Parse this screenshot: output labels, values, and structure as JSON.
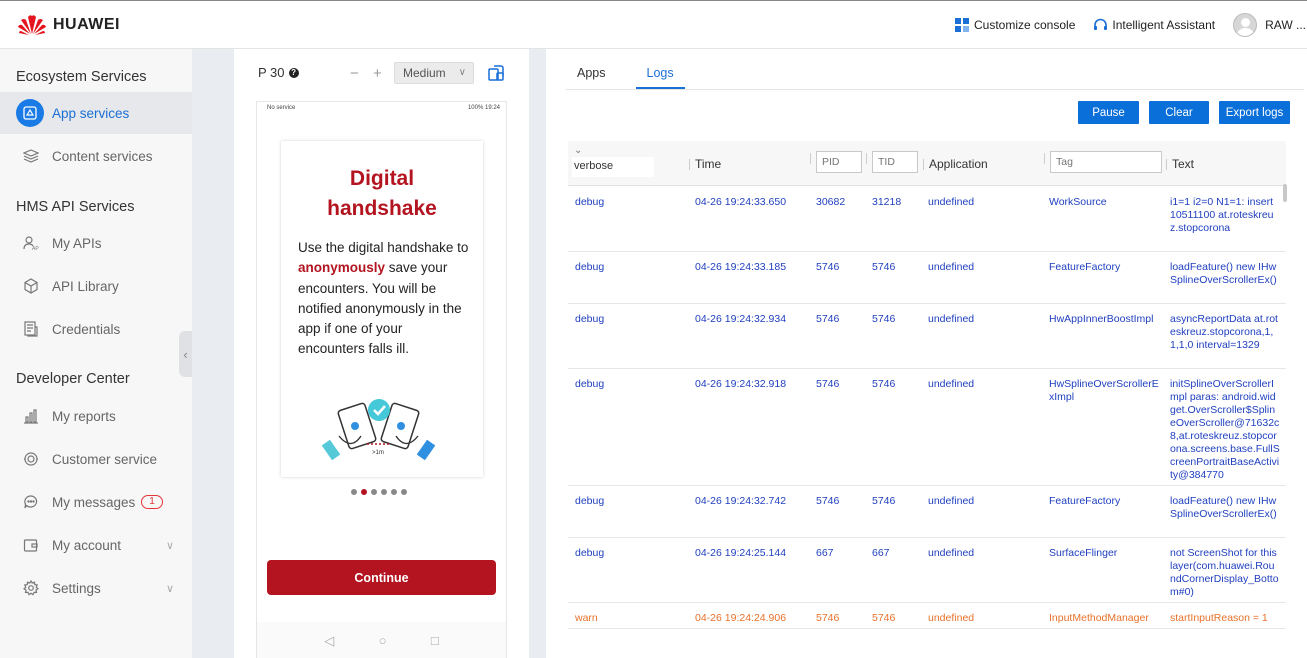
{
  "header": {
    "brand": "HUAWEI",
    "customize": "Customize console",
    "assistant": "Intelligent Assistant",
    "user": "RAW ..."
  },
  "sidebar": {
    "section1": "Ecosystem Services",
    "items1": [
      {
        "label": "App services",
        "icon": "app-services-icon"
      },
      {
        "label": "Content services",
        "icon": "layers-icon"
      }
    ],
    "section2": "HMS API Services",
    "items2": [
      {
        "label": "My APIs",
        "icon": "api-user-icon"
      },
      {
        "label": "API Library",
        "icon": "cube-icon"
      },
      {
        "label": "Credentials",
        "icon": "document-icon"
      }
    ],
    "section3": "Developer Center",
    "items3": [
      {
        "label": "My reports",
        "icon": "bar-chart-icon"
      },
      {
        "label": "Customer service",
        "icon": "headset-icon"
      },
      {
        "label": "My messages",
        "icon": "chat-icon",
        "badge": "1"
      },
      {
        "label": "My account",
        "icon": "wallet-icon"
      },
      {
        "label": "Settings",
        "icon": "gear-icon"
      }
    ]
  },
  "device": {
    "model": "P 30",
    "minus": "−",
    "plus": "+",
    "size": "Medium",
    "status_left": "No service",
    "status_right": "100% 19:24",
    "title_line1": "Digital",
    "title_line2": "handshake",
    "body_pre": "Use the digital handshake to ",
    "body_highlight": "anonymously",
    "body_post": " save your encounters. You will be notified anonymously in the app if one of your encounters falls ill.",
    "distance_label": ">1m",
    "continue": "Continue",
    "nav_back": "◁",
    "nav_home": "○",
    "nav_recent": "□"
  },
  "logs": {
    "tabs": [
      "Apps",
      "Logs"
    ],
    "active_tab": "Logs",
    "buttons": {
      "pause": "Pause",
      "clear": "Clear",
      "export": "Export logs"
    },
    "columns": {
      "level": "verbose",
      "time": "Time",
      "pid_placeholder": "PID",
      "tid_placeholder": "TID",
      "application": "Application",
      "tag_placeholder": "Tag",
      "text": "Text"
    },
    "rows": [
      {
        "level": "debug",
        "time": "04-26 19:24:33.650",
        "pid": "30682",
        "tid": "31218",
        "app": "undefined",
        "tag": "WorkSource",
        "text": "i1=1 i2=0 N1=1: insert 10511100 at.roteskreuz.stopcorona"
      },
      {
        "level": "debug",
        "time": "04-26 19:24:33.185",
        "pid": "5746",
        "tid": "5746",
        "app": "undefined",
        "tag": "FeatureFactory",
        "text": "loadFeature() new IHwSplineOverScrollerEx()"
      },
      {
        "level": "debug",
        "time": "04-26 19:24:32.934",
        "pid": "5746",
        "tid": "5746",
        "app": "undefined",
        "tag": "HwAppInnerBoostImpl",
        "text": "asyncReportData at.roteskreuz.stopcorona,1,1,1,0 interval=1329"
      },
      {
        "level": "debug",
        "time": "04-26 19:24:32.918",
        "pid": "5746",
        "tid": "5746",
        "app": "undefined",
        "tag": "HwSplineOverScrollerExImpl",
        "text": "initSplineOverScrollerImpl paras: android.widget.OverScroller$SplineOverScroller@71632c8,at.roteskreuz.stopcorona.screens.base.FullScreenPortraitBaseActivity@384770"
      },
      {
        "level": "debug",
        "time": "04-26 19:24:32.742",
        "pid": "5746",
        "tid": "5746",
        "app": "undefined",
        "tag": "FeatureFactory",
        "text": "loadFeature() new IHwSplineOverScrollerEx()"
      },
      {
        "level": "debug",
        "time": "04-26 19:24:25.144",
        "pid": "667",
        "tid": "667",
        "app": "undefined",
        "tag": "SurfaceFlinger",
        "text": "not ScreenShot for this layer(com.huawei.RoundCornerDisplay_Bottom#0)"
      },
      {
        "level": "warn",
        "time": "04-26 19:24:24.906",
        "pid": "5746",
        "tid": "5746",
        "app": "undefined",
        "tag": "InputMethodManager",
        "text": "startInputReason = 1"
      }
    ]
  },
  "colors": {
    "accent": "#1a6fd6",
    "brand_red": "#b3141f",
    "warn": "#e8712a",
    "debug": "#1f3fbf"
  }
}
